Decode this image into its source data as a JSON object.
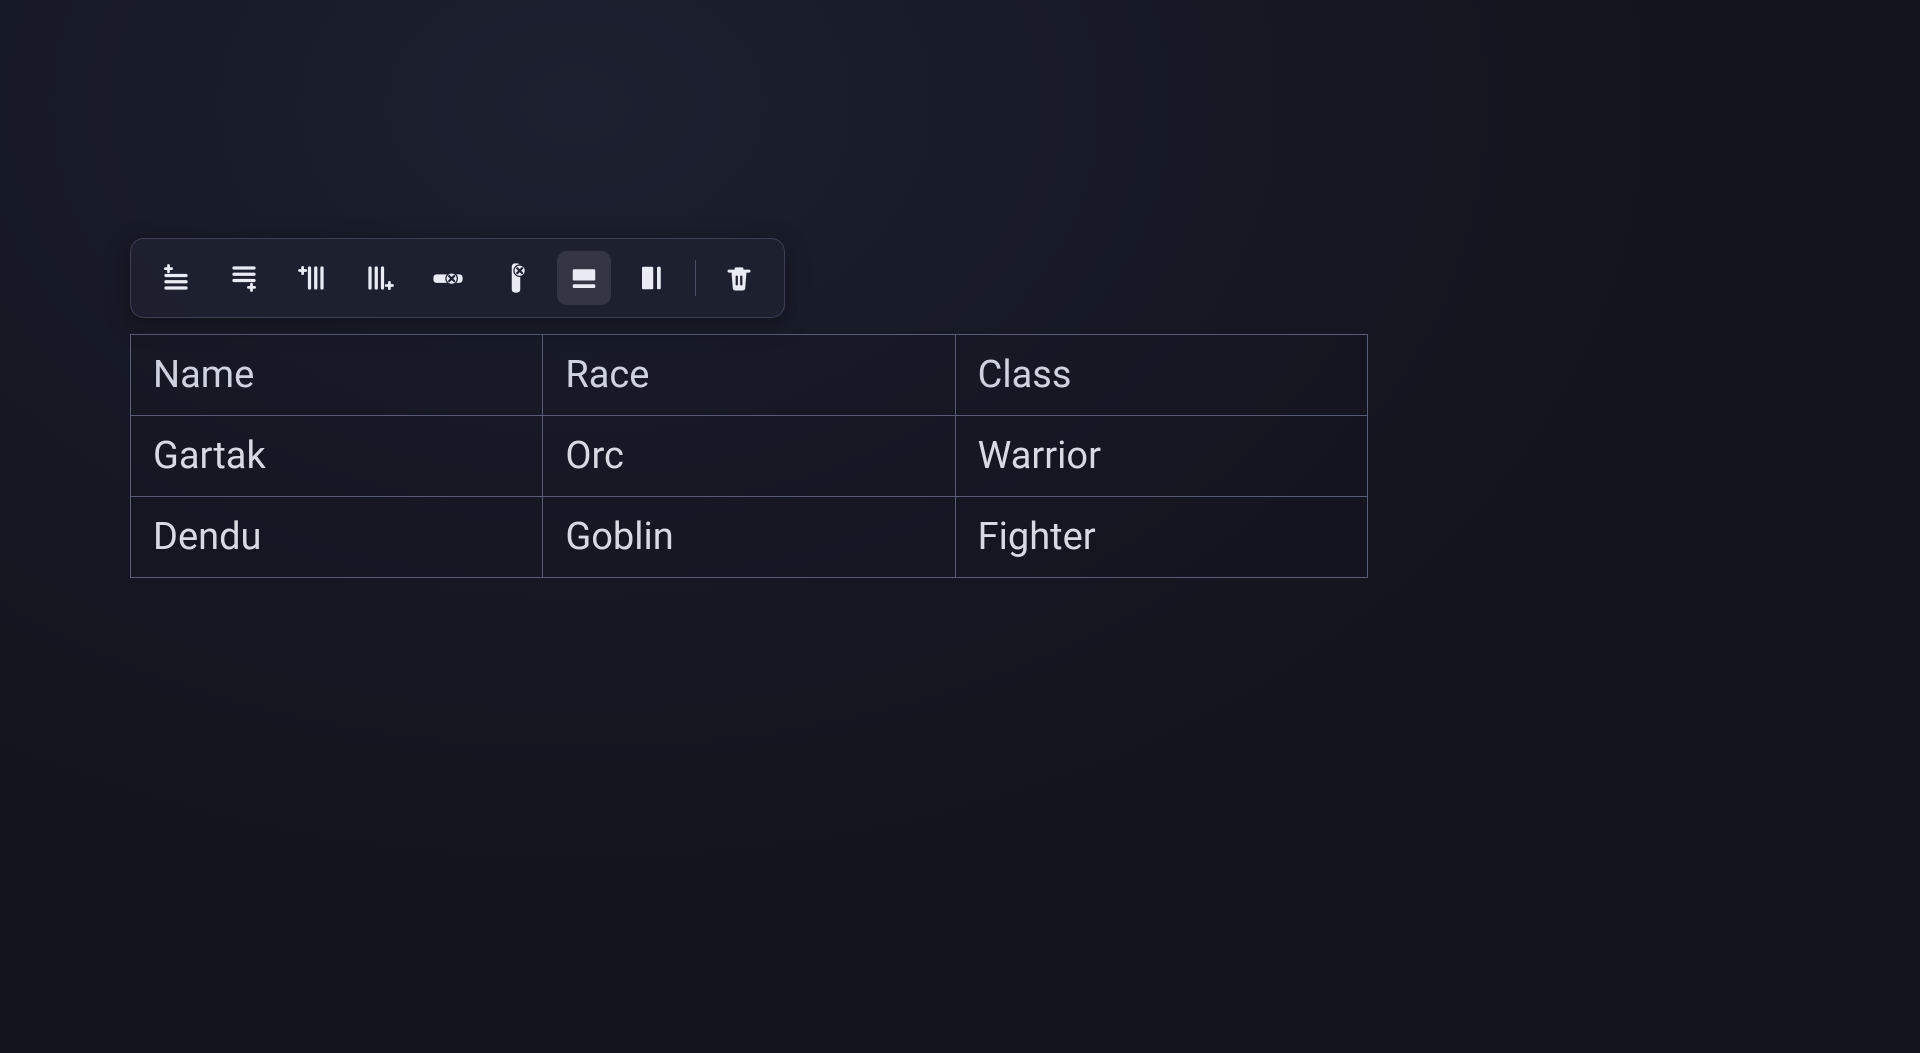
{
  "toolbar": {
    "buttons": [
      {
        "id": "insert-row-above",
        "icon": "row-insert-above-icon",
        "active": false
      },
      {
        "id": "insert-row-below",
        "icon": "row-insert-below-icon",
        "active": false
      },
      {
        "id": "insert-column-left",
        "icon": "col-insert-left-icon",
        "active": false
      },
      {
        "id": "insert-column-right",
        "icon": "col-insert-right-icon",
        "active": false
      },
      {
        "id": "delete-row",
        "icon": "row-delete-icon",
        "active": false
      },
      {
        "id": "delete-column",
        "icon": "col-delete-icon",
        "active": false
      },
      {
        "id": "toggle-header-row",
        "icon": "header-row-icon",
        "active": true
      },
      {
        "id": "toggle-header-column",
        "icon": "header-column-icon",
        "active": false
      },
      {
        "id": "delete-table",
        "icon": "trash-icon",
        "active": false
      }
    ],
    "divider_after_index": 7
  },
  "table": {
    "headers": [
      "Name",
      "Race",
      "Class"
    ],
    "rows": [
      [
        "Gartak",
        "Orc",
        "Warrior"
      ],
      [
        "Dendu",
        "Goblin",
        "Fighter"
      ]
    ]
  }
}
